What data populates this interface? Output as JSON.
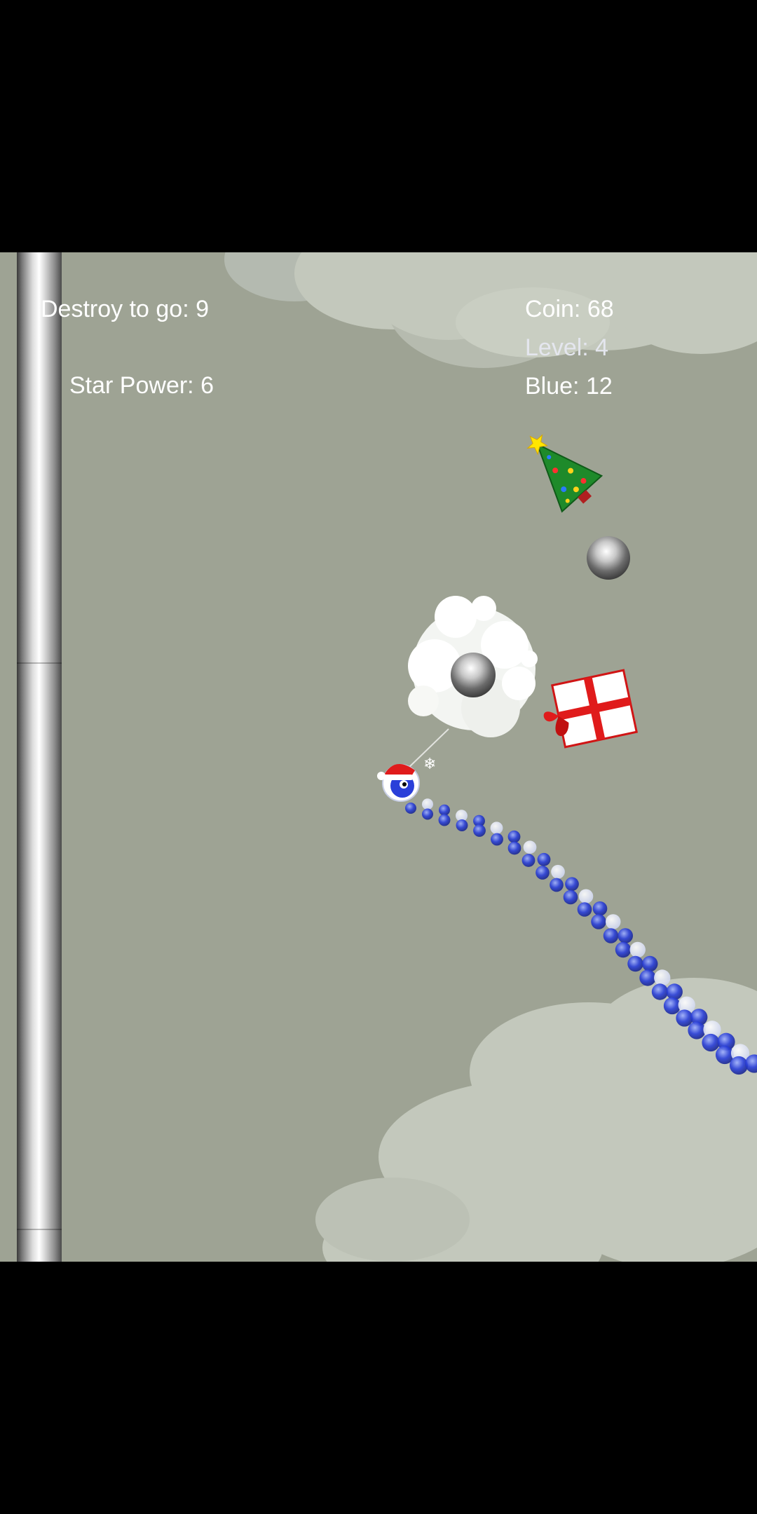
{
  "hud": {
    "destroy_to_go": "Destroy to go: 9",
    "star_power": "Star Power: 6",
    "coin": "Coin: 68",
    "level": "Level: 4",
    "blue": "Blue: 12"
  },
  "colors": {
    "background": "#9ea394",
    "cloud": "#c3c8bc",
    "trail_blue": "#2a3fd9",
    "gift_red": "#e01b1b",
    "tree_green": "#1e8a2a"
  },
  "icons": {
    "pause": "pause-icon",
    "tree": "christmas-tree-icon",
    "gift": "gift-box-icon",
    "player": "santa-ball-icon"
  }
}
